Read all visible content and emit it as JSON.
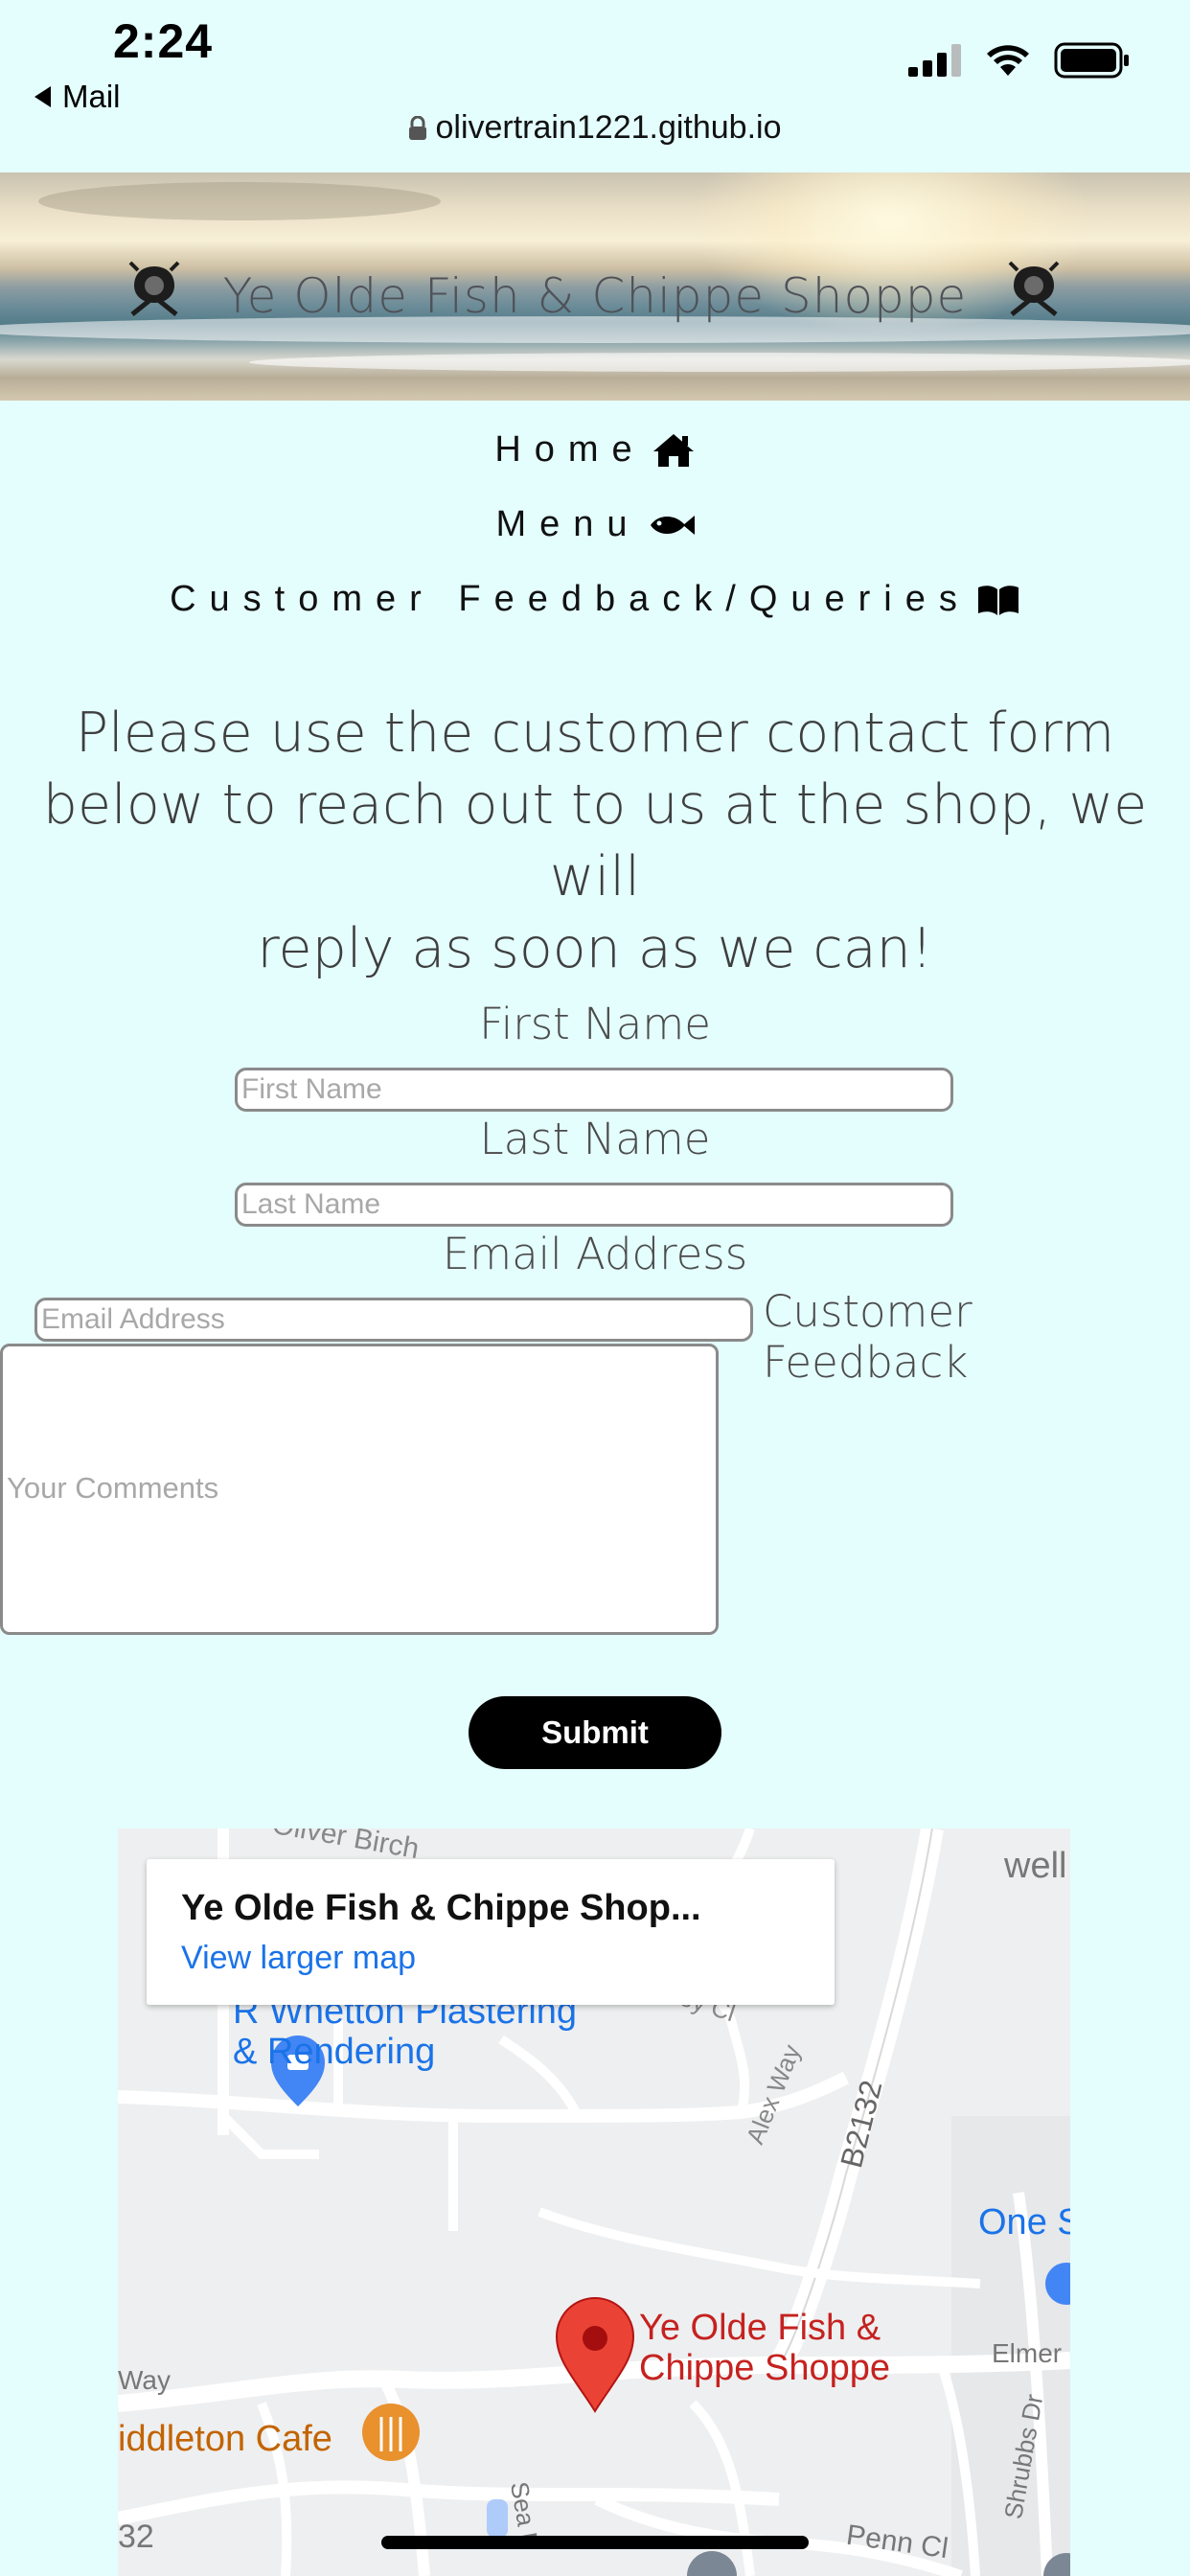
{
  "status_bar": {
    "time": "2:24",
    "back_label": "Mail",
    "url": "olivertrain1221.github.io"
  },
  "hero": {
    "title": "Ye Olde Fish & Chippe Shoppe"
  },
  "nav": {
    "home": "Home",
    "menu": "Menu",
    "feedback": "Customer Feedback/Queries"
  },
  "intro": {
    "line1": "Please use the customer contact form",
    "line2": "below to reach out to us at the shop, we will",
    "line3": "reply as soon as we can!"
  },
  "form": {
    "first_name_label": "First Name",
    "first_name_placeholder": "First Name",
    "last_name_label": "Last Name",
    "last_name_placeholder": "Last Name",
    "email_label": "Email Address",
    "email_placeholder": "Email Address",
    "feedback_label": "Customer Feedback",
    "comments_placeholder": "Your Comments",
    "submit_label": "Submit"
  },
  "map": {
    "card_title": "Ye Olde Fish & Chippe Shop...",
    "card_link": "View larger map",
    "labels": {
      "top_street": "Oliver Birch",
      "top_right": "well",
      "business_line1": "R Whetton Plastering",
      "business_line2": "& Rendering",
      "close_street": "ley Cl",
      "alex_way": "Alex Way",
      "b2132": "B2132",
      "one_s": "One S",
      "shop_line1": "Ye Olde Fish &",
      "shop_line2": "Chippe Shoppe",
      "elmer": "Elmer",
      "way": "Way",
      "cafe": "iddleton Cafe",
      "shrubbs": "Shrubbs Dr",
      "sea_lane": "Sea L",
      "penn_cl": "Penn Cl",
      "num_32": "32"
    }
  }
}
